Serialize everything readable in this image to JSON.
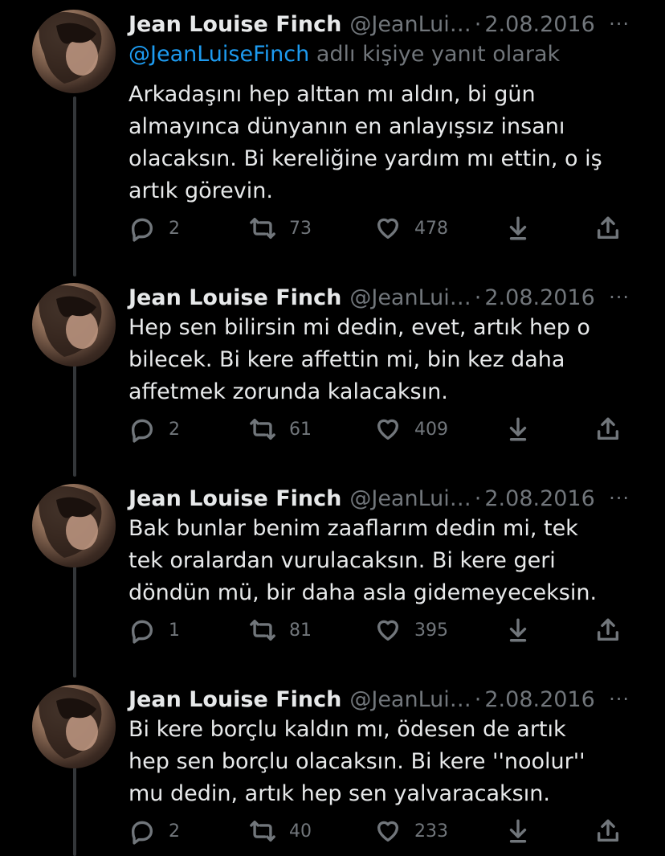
{
  "tweets": [
    {
      "name": "Jean Louise Finch",
      "handle": "@JeanLui…",
      "separator": "·",
      "date": "2.08.2016",
      "more": "···",
      "reply_mention": "@JeanLuiseFinch",
      "reply_suffix": " adlı kişiye yanıt olarak",
      "text": "Arkadaşını hep alttan mı aldın, bi gün almayınca dünyanın en anlayışsız insanı olacaksın. Bi kereliğine yardım mı ettin, o iş artık görevin.",
      "replies": "2",
      "retweets": "73",
      "likes": "478"
    },
    {
      "name": "Jean Louise Finch",
      "handle": "@JeanLui…",
      "separator": "·",
      "date": "2.08.2016",
      "more": "···",
      "text": "Hep sen bilirsin mi dedin, evet, artık hep o bilecek. Bi kere affettin mi, bin kez daha affetmek zorunda kalacaksın.",
      "replies": "2",
      "retweets": "61",
      "likes": "409"
    },
    {
      "name": "Jean Louise Finch",
      "handle": "@JeanLui…",
      "separator": "·",
      "date": "2.08.2016",
      "more": "···",
      "text": "Bak bunlar benim zaaflarım dedin mi, tek tek oralardan vurulacaksın. Bi kere geri döndün mü, bir daha asla gidemeyeceksin.",
      "replies": "1",
      "retweets": "81",
      "likes": "395"
    },
    {
      "name": "Jean Louise Finch",
      "handle": "@JeanLui…",
      "separator": "·",
      "date": "2.08.2016",
      "more": "···",
      "text": "Bi kere borçlu kaldın mı, ödesen de artık hep sen borçlu olacaksın. Bi kere ''noolur'' mu dedin, artık hep sen yalvaracaksın.",
      "replies": "2",
      "retweets": "40",
      "likes": "233"
    }
  ],
  "icons": {
    "reply": "reply-icon",
    "retweet": "retweet-icon",
    "like": "heart-icon",
    "download": "download-icon",
    "share": "share-icon"
  },
  "colors": {
    "background": "#000000",
    "text": "#e7e9ea",
    "muted": "#71767b",
    "link": "#1d9bf0",
    "thread_line": "#333639"
  }
}
